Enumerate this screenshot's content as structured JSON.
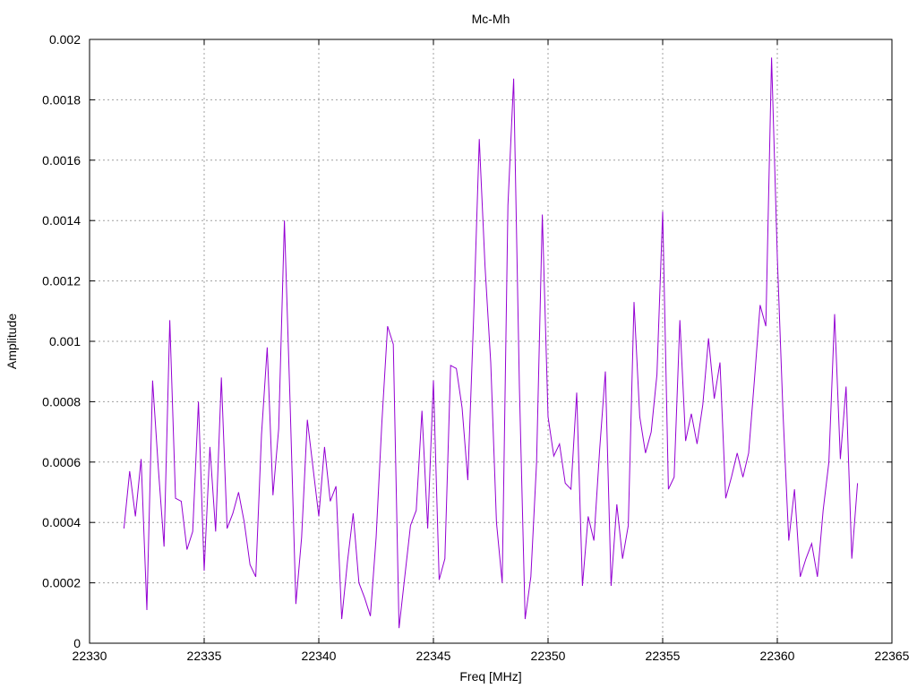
{
  "chart_data": {
    "type": "line",
    "title": "Mc-Mh",
    "xlabel": "Freq [MHz]",
    "ylabel": "Amplitude",
    "xlim": [
      22330,
      22365
    ],
    "ylim": [
      0,
      0.002
    ],
    "x_ticks": [
      "22330",
      "22335",
      "22340",
      "22345",
      "22350",
      "22355",
      "22360",
      "22365"
    ],
    "y_ticks": [
      "0",
      "0.0002",
      "0.0004",
      "0.0006",
      "0.0008",
      "0.001",
      "0.0012",
      "0.0014",
      "0.0016",
      "0.0018",
      "0.002"
    ],
    "grid": true,
    "line_color": "#9400d3",
    "series": [
      {
        "x": [
          22331.5,
          22331.75,
          22332.0,
          22332.25,
          22332.5,
          22332.75,
          22333.0,
          22333.25,
          22333.5,
          22333.75,
          22334.0,
          22334.25,
          22334.5,
          22334.75,
          22335.0,
          22335.25,
          22335.5,
          22335.75,
          22336.0,
          22336.25,
          22336.5,
          22336.75,
          22337.0,
          22337.25,
          22337.5,
          22337.75,
          22338.0,
          22338.25,
          22338.5,
          22338.75,
          22339.0,
          22339.25,
          22339.5,
          22339.75,
          22340.0,
          22340.25,
          22340.5,
          22340.75,
          22341.0,
          22341.25,
          22341.5,
          22341.75,
          22342.0,
          22342.25,
          22342.5,
          22342.75,
          22343.0,
          22343.25,
          22343.5,
          22343.75,
          22344.0,
          22344.25,
          22344.5,
          22344.75,
          22345.0,
          22345.25,
          22345.5,
          22345.75,
          22346.0,
          22346.25,
          22346.5,
          22346.75,
          22347.0,
          22347.25,
          22347.5,
          22347.75,
          22348.0,
          22348.25,
          22348.5,
          22348.75,
          22349.0,
          22349.25,
          22349.5,
          22349.75,
          22350.0,
          22350.25,
          22350.5,
          22350.75,
          22351.0,
          22351.25,
          22351.5,
          22351.75,
          22352.0,
          22352.25,
          22352.5,
          22352.75,
          22353.0,
          22353.25,
          22353.5,
          22353.75,
          22354.0,
          22354.25,
          22354.5,
          22354.75,
          22355.0,
          22355.25,
          22355.5,
          22355.75,
          22356.0,
          22356.25,
          22356.5,
          22356.75,
          22357.0,
          22357.25,
          22357.5,
          22357.75,
          22358.0,
          22358.25,
          22358.5,
          22358.75,
          22359.0,
          22359.25,
          22359.5,
          22359.75,
          22360.0,
          22360.25,
          22360.5,
          22360.75,
          22361.0,
          22361.25,
          22361.5,
          22361.75,
          22362.0,
          22362.25,
          22362.5,
          22362.75,
          22363.0,
          22363.25,
          22363.5
        ],
        "values": [
          0.00038,
          0.00057,
          0.00042,
          0.00061,
          0.00011,
          0.00087,
          0.00058,
          0.00032,
          0.00107,
          0.00048,
          0.00047,
          0.00031,
          0.00037,
          0.0008,
          0.00024,
          0.00065,
          0.00037,
          0.00088,
          0.00038,
          0.00043,
          0.0005,
          0.0004,
          0.00026,
          0.00022,
          0.00069,
          0.00098,
          0.00049,
          0.00071,
          0.0014,
          0.00079,
          0.00013,
          0.00035,
          0.00074,
          0.00058,
          0.00042,
          0.00065,
          0.00047,
          0.00052,
          8e-05,
          0.00027,
          0.00043,
          0.0002,
          0.00015,
          9e-05,
          0.00035,
          0.00073,
          0.00105,
          0.00099,
          5e-05,
          0.00022,
          0.00039,
          0.00044,
          0.00077,
          0.00038,
          0.00087,
          0.00021,
          0.00028,
          0.00092,
          0.00091,
          0.00078,
          0.00054,
          0.00107,
          0.00167,
          0.00125,
          0.00093,
          0.0004,
          0.0002,
          0.00145,
          0.00187,
          0.00085,
          8e-05,
          0.00022,
          0.0006,
          0.00142,
          0.00075,
          0.00062,
          0.00066,
          0.00053,
          0.00051,
          0.00083,
          0.00019,
          0.00042,
          0.00034,
          0.00064,
          0.0009,
          0.00019,
          0.00046,
          0.00028,
          0.00039,
          0.00113,
          0.00075,
          0.00063,
          0.0007,
          0.00089,
          0.00143,
          0.00051,
          0.00055,
          0.00107,
          0.00067,
          0.00076,
          0.00066,
          0.00079,
          0.00101,
          0.00081,
          0.00093,
          0.00048,
          0.00055,
          0.00063,
          0.00055,
          0.00063,
          0.00087,
          0.00112,
          0.00105,
          0.00194,
          0.00128,
          0.00076,
          0.00034,
          0.00051,
          0.00022,
          0.00028,
          0.00033,
          0.00022,
          0.00044,
          0.0006,
          0.00109,
          0.00061,
          0.00085,
          0.00028,
          0.00053
        ]
      }
    ]
  }
}
